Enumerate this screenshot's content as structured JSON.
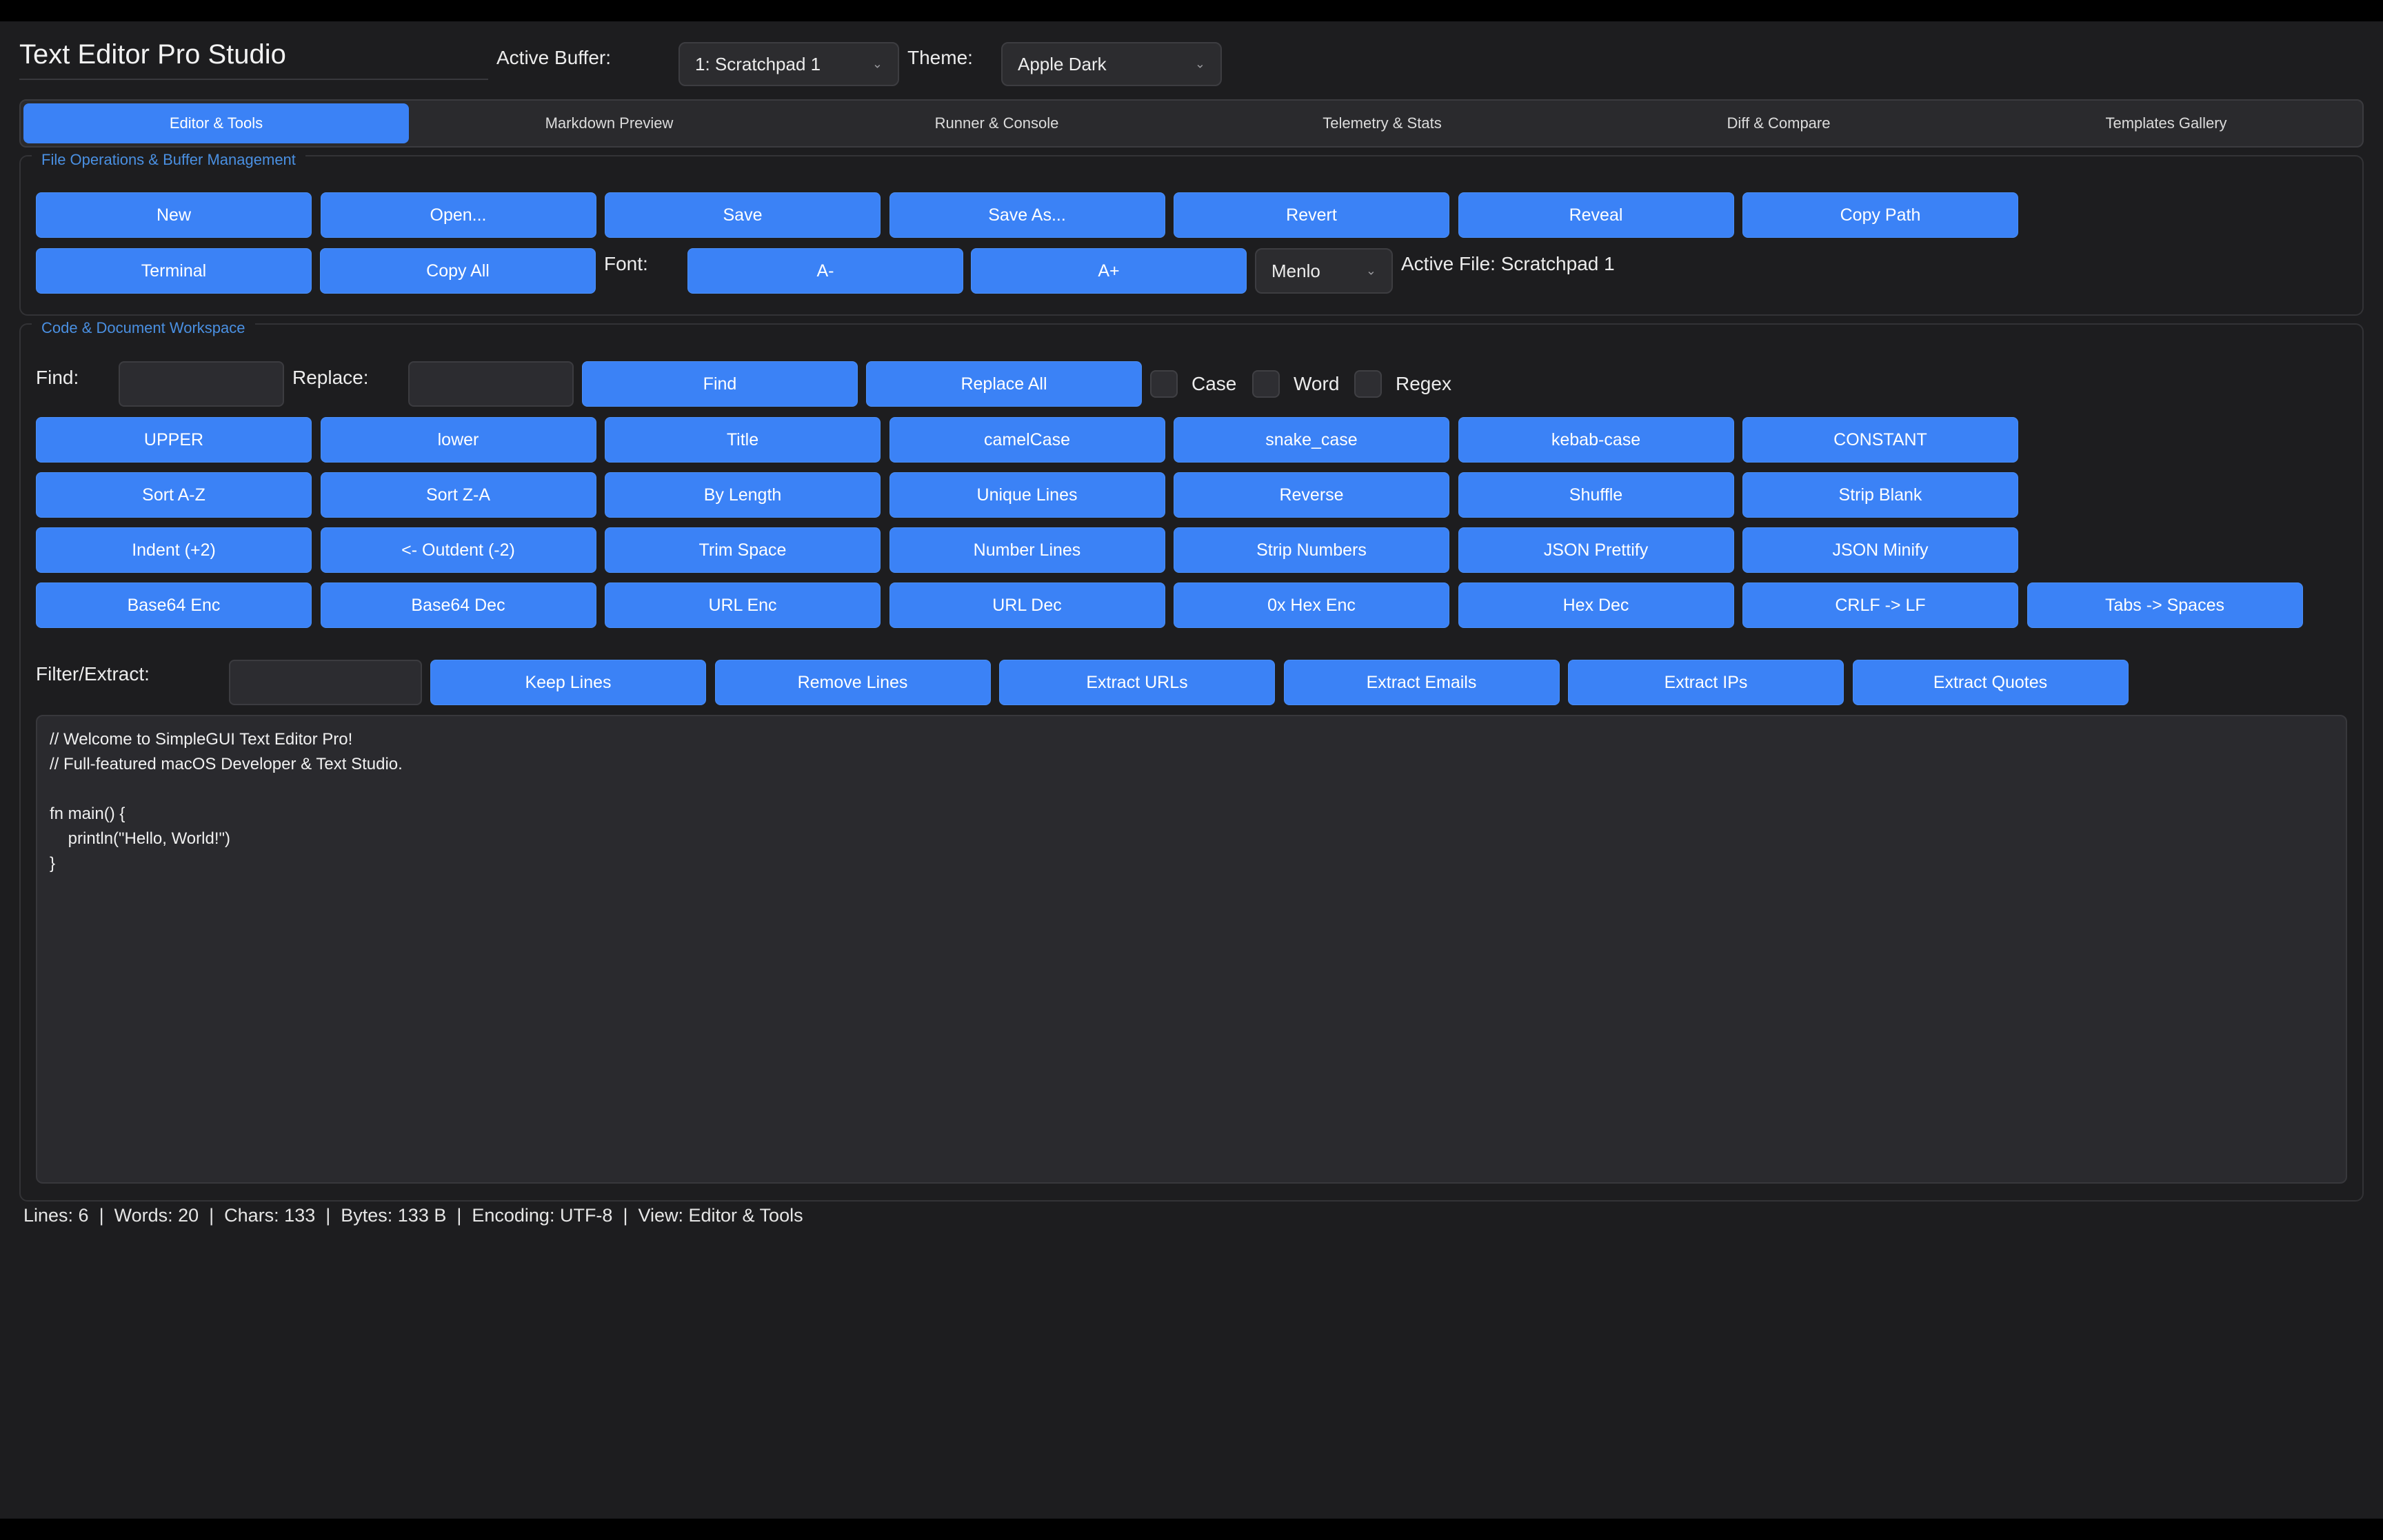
{
  "header": {
    "app_title": "Text Editor Pro Studio",
    "active_buffer_label": "Active Buffer:",
    "active_buffer_value": "1: Scratchpad 1",
    "theme_label": "Theme:",
    "theme_value": "Apple Dark"
  },
  "tabs": [
    {
      "label": "Editor & Tools",
      "active": true
    },
    {
      "label": "Markdown Preview",
      "active": false
    },
    {
      "label": "Runner & Console",
      "active": false
    },
    {
      "label": "Telemetry & Stats",
      "active": false
    },
    {
      "label": "Diff & Compare",
      "active": false
    },
    {
      "label": "Templates Gallery",
      "active": false
    }
  ],
  "file_ops": {
    "title": "File Operations & Buffer Management",
    "row1": [
      "New",
      "Open...",
      "Save",
      "Save As...",
      "Revert",
      "Reveal",
      "Copy Path"
    ],
    "row2": [
      "Terminal",
      "Copy All"
    ],
    "font_label": "Font:",
    "font_smaller": "A-",
    "font_larger": "A+",
    "font_family_value": "Menlo",
    "active_file_text": "Active File: Scratchpad 1"
  },
  "workspace": {
    "title": "Code & Document Workspace",
    "find_label": "Find:",
    "replace_label": "Replace:",
    "find_value": "",
    "replace_value": "",
    "find_button": "Find",
    "replace_all_button": "Replace All",
    "checkboxes": [
      {
        "label": "Case",
        "checked": false
      },
      {
        "label": "Word",
        "checked": false
      },
      {
        "label": "Regex",
        "checked": false
      }
    ],
    "case_row": [
      "UPPER",
      "lower",
      "Title",
      "camelCase",
      "snake_case",
      "kebab-case",
      "CONSTANT"
    ],
    "sort_row": [
      "Sort A-Z",
      "Sort Z-A",
      "By Length",
      "Unique Lines",
      "Reverse",
      "Shuffle",
      "Strip Blank"
    ],
    "format_row": [
      "Indent (+2)",
      "<- Outdent (-2)",
      "Trim Space",
      "Number Lines",
      "Strip Numbers",
      "JSON Prettify",
      "JSON Minify"
    ],
    "encode_row": [
      "Base64 Enc",
      "Base64 Dec",
      "URL Enc",
      "URL Dec",
      "0x Hex Enc",
      "Hex Dec",
      "CRLF -> LF",
      "Tabs -> Spaces"
    ],
    "filter_label": "Filter/Extract:",
    "filter_value": "",
    "filter_row": [
      "Keep Lines",
      "Remove Lines",
      "Extract URLs",
      "Extract Emails",
      "Extract IPs",
      "Extract Quotes"
    ],
    "editor_text": "// Welcome to SimpleGUI Text Editor Pro!\n// Full-featured macOS Developer & Text Studio.\n\nfn main() {\n    println(\"Hello, World!\")\n}"
  },
  "status_bar": "Lines: 6  |  Words: 20  |  Chars: 133  |  Bytes: 133 B  |  Encoding: UTF-8  |  View: Editor & Tools",
  "colors": {
    "accent": "#3b82f6",
    "background": "#1d1d1f",
    "group_title": "#4a90e2"
  }
}
